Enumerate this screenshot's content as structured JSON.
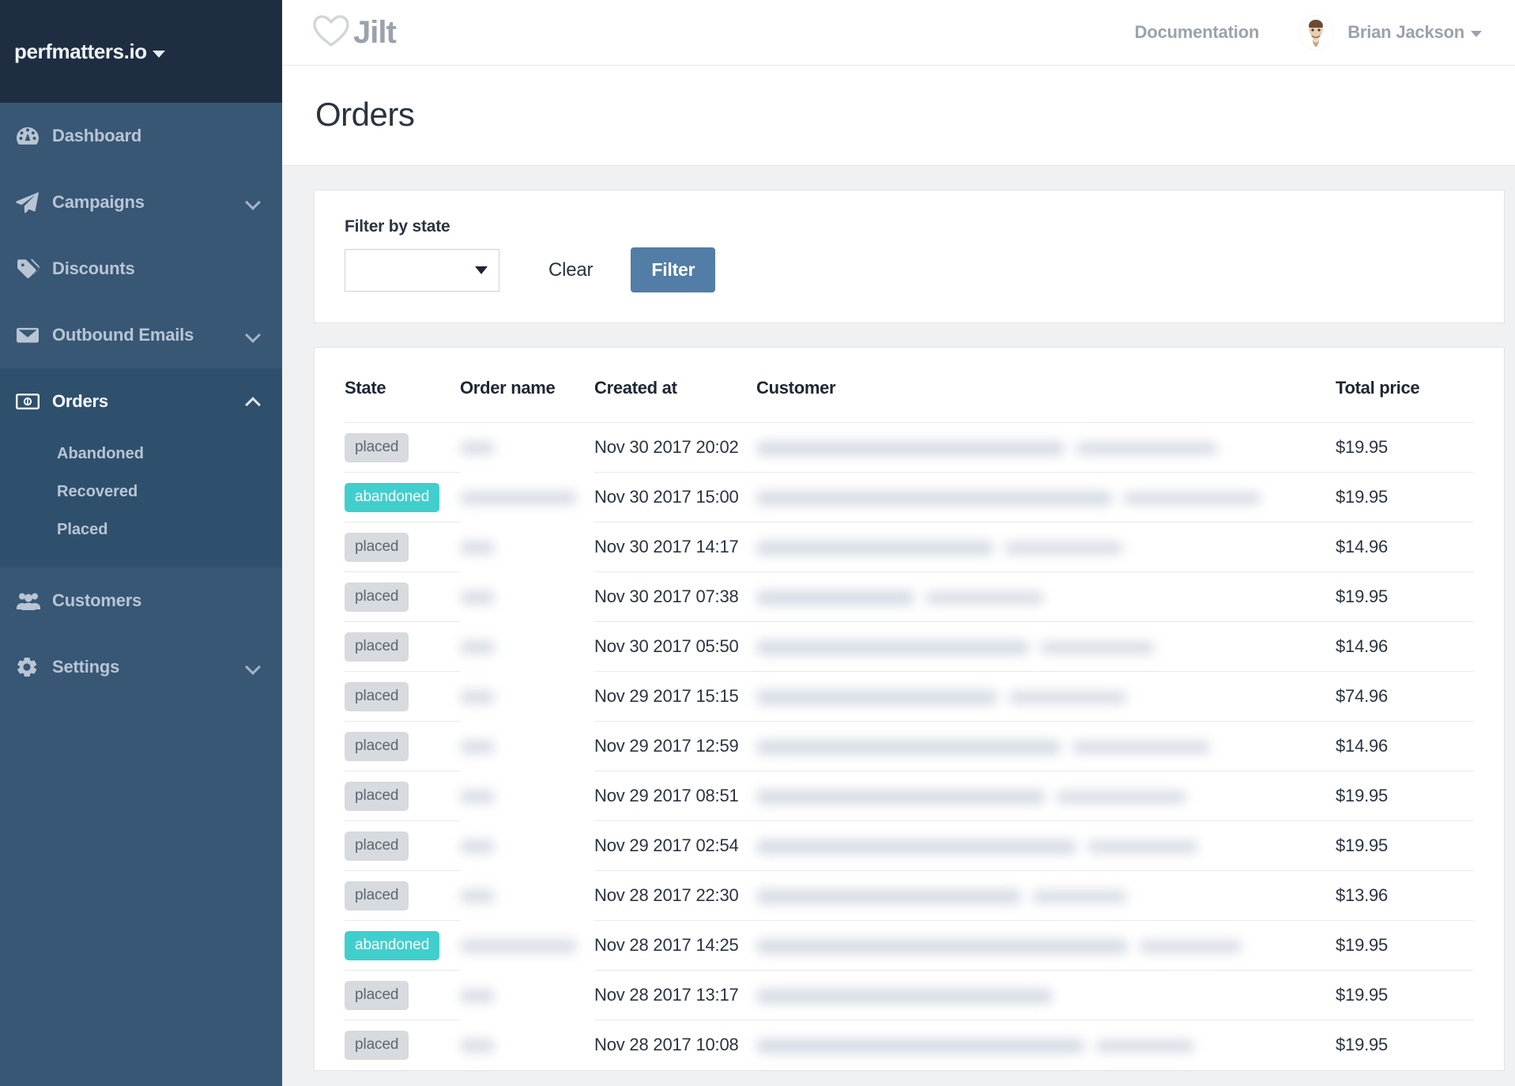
{
  "sidebar": {
    "brand": {
      "label": "perfmatters.io",
      "caret_icon": "caret-down-icon"
    },
    "items": [
      {
        "label": "Dashboard",
        "icon": "dashboard-icon",
        "expandable": false,
        "active": false
      },
      {
        "label": "Campaigns",
        "icon": "paper-plane-icon",
        "expandable": true,
        "active": false
      },
      {
        "label": "Discounts",
        "icon": "tag-icon",
        "expandable": false,
        "active": false
      },
      {
        "label": "Outbound Emails",
        "icon": "envelope-icon",
        "expandable": true,
        "active": false
      },
      {
        "label": "Orders",
        "icon": "money-bill-icon",
        "expandable": true,
        "active": true,
        "subitems": [
          {
            "label": "Abandoned"
          },
          {
            "label": "Recovered"
          },
          {
            "label": "Placed"
          }
        ]
      },
      {
        "label": "Customers",
        "icon": "users-icon",
        "expandable": false,
        "active": false
      },
      {
        "label": "Settings",
        "icon": "gear-icon",
        "expandable": true,
        "active": false
      }
    ]
  },
  "topbar": {
    "logo_text": "Jilt",
    "logo_icon": "heart-outline-icon",
    "documentation_link": "Documentation",
    "user_name": "Brian Jackson",
    "avatar_icon": "user-avatar",
    "user_caret_icon": "caret-down-icon"
  },
  "page": {
    "title": "Orders"
  },
  "filter": {
    "label": "Filter by state",
    "select_value": "",
    "select_placeholder": "",
    "select_caret_icon": "caret-down-icon",
    "clear_label": "Clear",
    "filter_label": "Filter"
  },
  "table": {
    "columns": [
      "State",
      "Order name",
      "Created at",
      "Customer",
      "Total price"
    ],
    "rows": [
      {
        "state": "placed",
        "created_at": "Nov 30 2017 20:02",
        "total_price": "$19.95"
      },
      {
        "state": "abandoned",
        "created_at": "Nov 30 2017 15:00",
        "total_price": "$19.95"
      },
      {
        "state": "placed",
        "created_at": "Nov 30 2017 14:17",
        "total_price": "$14.96"
      },
      {
        "state": "placed",
        "created_at": "Nov 30 2017 07:38",
        "total_price": "$19.95"
      },
      {
        "state": "placed",
        "created_at": "Nov 30 2017 05:50",
        "total_price": "$14.96"
      },
      {
        "state": "placed",
        "created_at": "Nov 29 2017 15:15",
        "total_price": "$74.96"
      },
      {
        "state": "placed",
        "created_at": "Nov 29 2017 12:59",
        "total_price": "$14.96"
      },
      {
        "state": "placed",
        "created_at": "Nov 29 2017 08:51",
        "total_price": "$19.95"
      },
      {
        "state": "placed",
        "created_at": "Nov 29 2017 02:54",
        "total_price": "$19.95"
      },
      {
        "state": "placed",
        "created_at": "Nov 28 2017 22:30",
        "total_price": "$13.96"
      },
      {
        "state": "abandoned",
        "created_at": "Nov 28 2017 14:25",
        "total_price": "$19.95"
      },
      {
        "state": "placed",
        "created_at": "Nov 28 2017 13:17",
        "total_price": "$19.95"
      },
      {
        "state": "placed",
        "created_at": "Nov 28 2017 10:08",
        "total_price": "$19.95"
      }
    ]
  },
  "colors": {
    "sidebar_bg": "#375775",
    "sidebar_brand_bg": "#1e2d42",
    "sidebar_active_bg": "#2f506d",
    "accent_button": "#527da6",
    "badge_abandoned": "#40cfcd",
    "badge_placed": "#d7dade",
    "page_bg": "#f0f1f2"
  }
}
